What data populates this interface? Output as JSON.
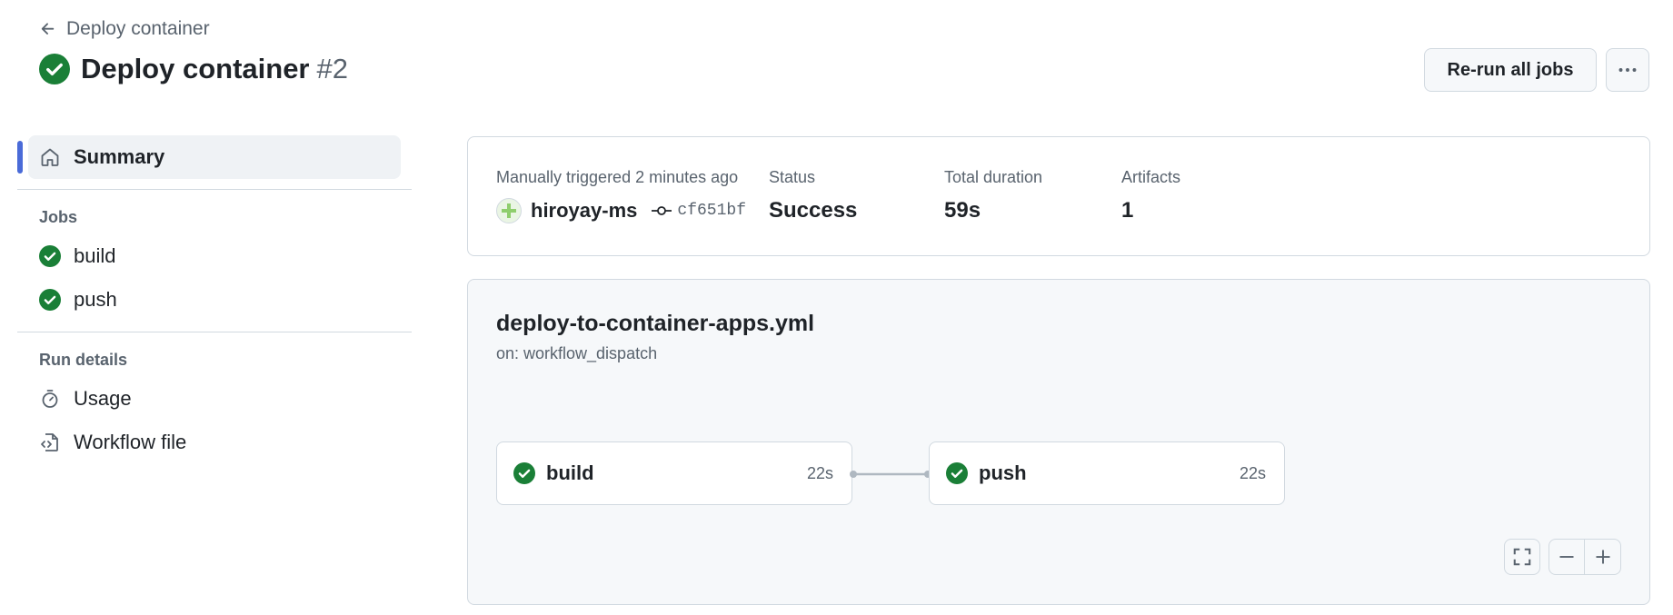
{
  "header": {
    "back_label": "Deploy container",
    "title": "Deploy container",
    "run_number": "#2",
    "rerun_label": "Re-run all jobs"
  },
  "sidebar": {
    "summary_label": "Summary",
    "jobs_title": "Jobs",
    "jobs": [
      {
        "label": "build",
        "icon": "check-circle-icon"
      },
      {
        "label": "push",
        "icon": "check-circle-icon"
      }
    ],
    "run_details_title": "Run details",
    "details": [
      {
        "label": "Usage",
        "icon": "stopwatch-icon"
      },
      {
        "label": "Workflow file",
        "icon": "file-code-icon"
      }
    ]
  },
  "summary": {
    "trigger_text": "Manually triggered 2 minutes ago",
    "user": "hiroyay-ms",
    "commit": "cf651bf",
    "status_label": "Status",
    "status_value": "Success",
    "duration_label": "Total duration",
    "duration_value": "59s",
    "artifacts_label": "Artifacts",
    "artifacts_value": "1"
  },
  "graph": {
    "file": "deploy-to-container-apps.yml",
    "trigger": "on: workflow_dispatch",
    "jobs": [
      {
        "name": "build",
        "duration": "22s"
      },
      {
        "name": "push",
        "duration": "22s"
      }
    ]
  },
  "colors": {
    "success": "#1a7f37",
    "accent": "#4a6bd8",
    "border": "#d1d9e0",
    "muted": "#59636e"
  }
}
